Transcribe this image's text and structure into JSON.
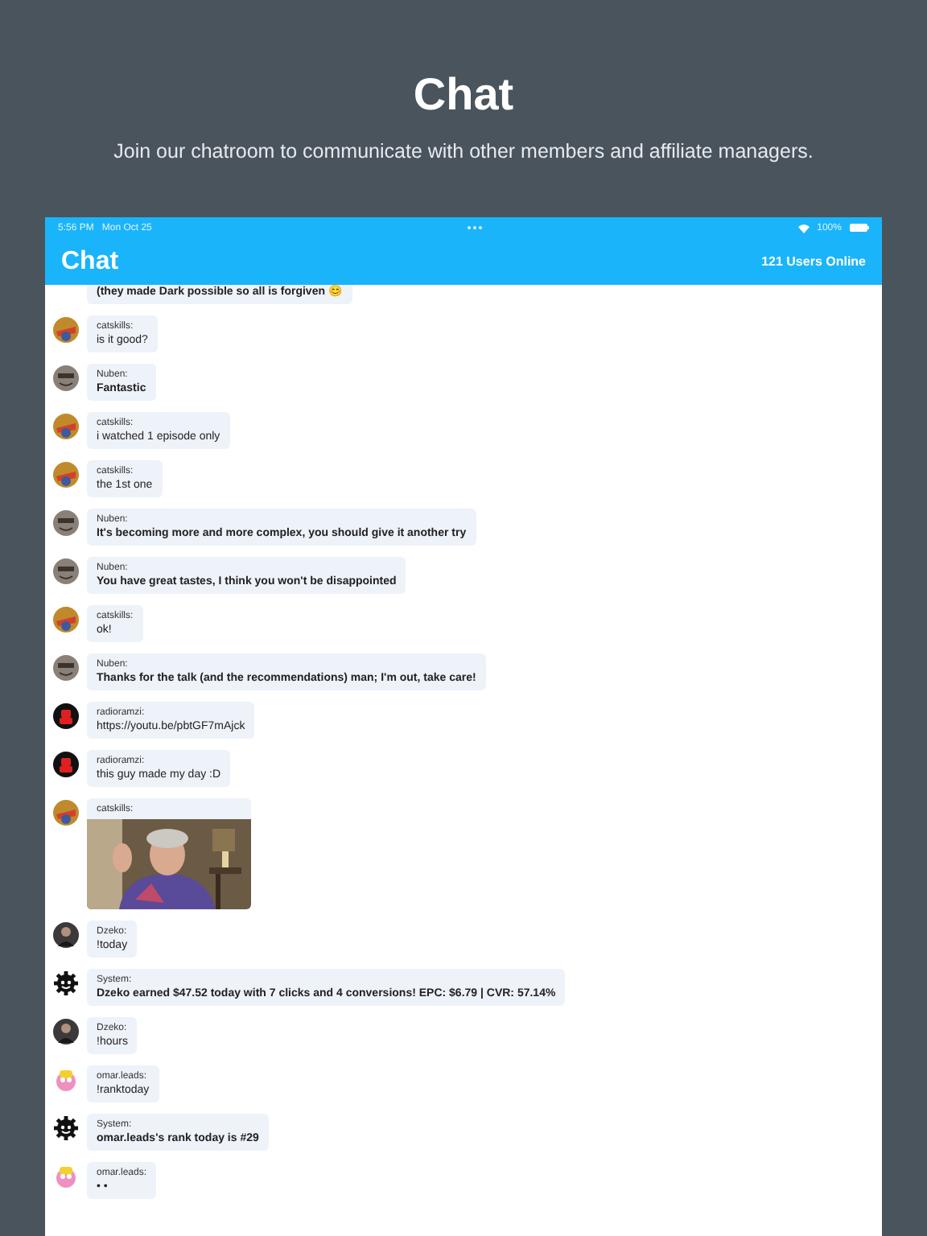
{
  "page": {
    "title": "Chat",
    "subtitle": "Join our chatroom to communicate with other members and affiliate managers."
  },
  "status_bar": {
    "time": "5:56 PM",
    "date": "Mon Oct 25",
    "battery": "100%"
  },
  "header": {
    "title": "Chat",
    "online": "121 Users Online"
  },
  "messages": [
    {
      "kind": "strong",
      "text": "(they made Dark possible so all is forgiven 😊"
    },
    {
      "author": "catskills:",
      "avatar": {
        "kind": "orange"
      },
      "kind": "text",
      "text": "is it good?"
    },
    {
      "author": "Nuben:",
      "avatar": {
        "kind": "grey"
      },
      "kind": "strong",
      "text": "Fantastic"
    },
    {
      "author": "catskills:",
      "avatar": {
        "kind": "orange"
      },
      "kind": "text",
      "text": "i watched 1 episode only"
    },
    {
      "author": "catskills:",
      "avatar": {
        "kind": "orange"
      },
      "kind": "text",
      "text": "the 1st one"
    },
    {
      "author": "Nuben:",
      "avatar": {
        "kind": "grey"
      },
      "kind": "strong",
      "text": "It's becoming more and more complex, you should give it another try"
    },
    {
      "author": "Nuben:",
      "avatar": {
        "kind": "grey"
      },
      "kind": "strong",
      "text": "You have great tastes, I think you won't be disappointed"
    },
    {
      "author": "catskills:",
      "avatar": {
        "kind": "orange"
      },
      "kind": "text",
      "text": "ok!"
    },
    {
      "author": "Nuben:",
      "avatar": {
        "kind": "grey"
      },
      "kind": "strong",
      "text": "Thanks for the talk (and the recommendations) man; I'm  out, take care!"
    },
    {
      "author": "radioramzi:",
      "avatar": {
        "kind": "robot"
      },
      "kind": "text",
      "text": "https://youtu.be/pbtGF7mAjck"
    },
    {
      "author": "radioramzi:",
      "avatar": {
        "kind": "robot"
      },
      "kind": "text",
      "text": "this guy made my day :D"
    },
    {
      "author": "catskills:",
      "avatar": {
        "kind": "orange"
      },
      "kind": "picture"
    },
    {
      "author": "Dzeko:",
      "avatar": {
        "kind": "dark"
      },
      "kind": "text",
      "text": "!today"
    },
    {
      "author": "System:",
      "avatar": {
        "kind": "gear"
      },
      "kind": "strong",
      "text": "Dzeko earned $47.52 today with 7 clicks and 4 conversions!  EPC: $6.79 | CVR: 57.14%"
    },
    {
      "author": "Dzeko:",
      "avatar": {
        "kind": "dark"
      },
      "kind": "text",
      "text": "!hours"
    },
    {
      "author": "omar.leads:",
      "avatar": {
        "kind": "pink"
      },
      "kind": "text",
      "text": "!ranktoday"
    },
    {
      "author": "System:",
      "avatar": {
        "kind": "gear"
      },
      "kind": "strong",
      "text": "omar.leads's rank today is #29"
    },
    {
      "author": "omar.leads:",
      "avatar": {
        "kind": "pink"
      },
      "kind": "text",
      "text": "• •"
    }
  ]
}
